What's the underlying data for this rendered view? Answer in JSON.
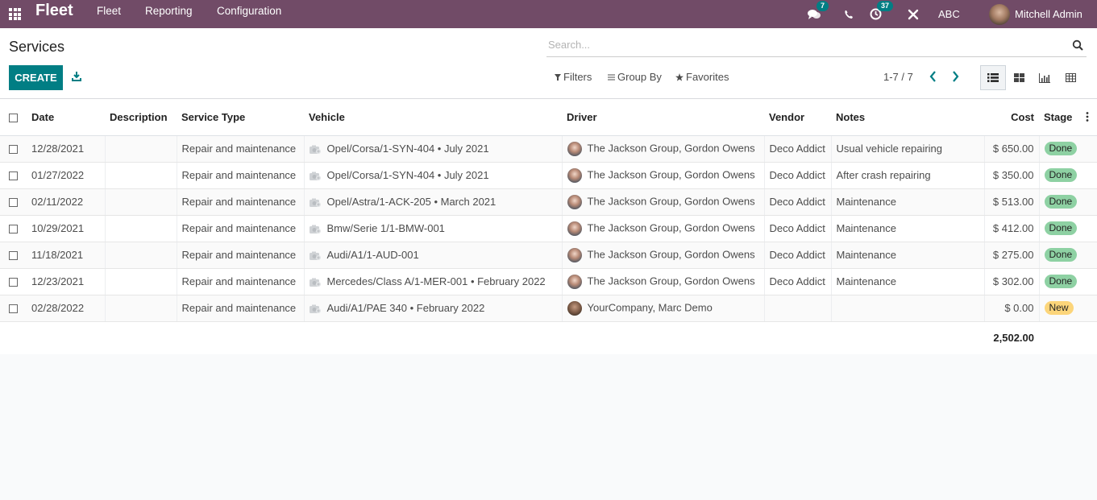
{
  "navbar": {
    "brand": "Fleet",
    "menu": [
      {
        "label": "Fleet"
      },
      {
        "label": "Reporting"
      },
      {
        "label": "Configuration"
      }
    ],
    "messages_count": "7",
    "activities_count": "37",
    "company": "ABC",
    "user": "Mitchell Admin"
  },
  "control_panel": {
    "title": "Services",
    "create_label": "CREATE",
    "search_placeholder": "Search...",
    "filters_label": "Filters",
    "group_by_label": "Group By",
    "favorites_label": "Favorites",
    "pager": "1-7 / 7"
  },
  "colors": {
    "brand": "#714b67",
    "primary": "#017e84",
    "done": "#8ed1a3",
    "new": "#fcd57a"
  },
  "table": {
    "columns": {
      "date": "Date",
      "description": "Description",
      "service_type": "Service Type",
      "vehicle": "Vehicle",
      "driver": "Driver",
      "vendor": "Vendor",
      "notes": "Notes",
      "cost": "Cost",
      "stage": "Stage"
    },
    "rows": [
      {
        "date": "12/28/2021",
        "description": "",
        "service_type": "Repair and maintenance",
        "vehicle": "Opel/Corsa/1-SYN-404 • July 2021",
        "driver": "The Jackson Group, Gordon Owens",
        "vendor": "Deco Addict",
        "notes": "Usual vehicle repairing",
        "cost": "$ 650.00",
        "stage": "Done"
      },
      {
        "date": "01/27/2022",
        "description": "",
        "service_type": "Repair and maintenance",
        "vehicle": "Opel/Corsa/1-SYN-404 • July 2021",
        "driver": "The Jackson Group, Gordon Owens",
        "vendor": "Deco Addict",
        "notes": "After crash repairing",
        "cost": "$ 350.00",
        "stage": "Done"
      },
      {
        "date": "02/11/2022",
        "description": "",
        "service_type": "Repair and maintenance",
        "vehicle": "Opel/Astra/1-ACK-205 • March 2021",
        "driver": "The Jackson Group, Gordon Owens",
        "vendor": "Deco Addict",
        "notes": "Maintenance",
        "cost": "$ 513.00",
        "stage": "Done"
      },
      {
        "date": "10/29/2021",
        "description": "",
        "service_type": "Repair and maintenance",
        "vehicle": "Bmw/Serie 1/1-BMW-001",
        "driver": "The Jackson Group, Gordon Owens",
        "vendor": "Deco Addict",
        "notes": "Maintenance",
        "cost": "$ 412.00",
        "stage": "Done"
      },
      {
        "date": "11/18/2021",
        "description": "",
        "service_type": "Repair and maintenance",
        "vehicle": "Audi/A1/1-AUD-001",
        "driver": "The Jackson Group, Gordon Owens",
        "vendor": "Deco Addict",
        "notes": "Maintenance",
        "cost": "$ 275.00",
        "stage": "Done"
      },
      {
        "date": "12/23/2021",
        "description": "",
        "service_type": "Repair and maintenance",
        "vehicle": "Mercedes/Class A/1-MER-001 • February 2022",
        "driver": "The Jackson Group, Gordon Owens",
        "vendor": "Deco Addict",
        "notes": "Maintenance",
        "cost": "$ 302.00",
        "stage": "Done"
      },
      {
        "date": "02/28/2022",
        "description": "",
        "service_type": "Repair and maintenance",
        "vehicle": "Audi/A1/PAE 340 • February 2022",
        "driver": "YourCompany, Marc Demo",
        "vendor": "",
        "notes": "",
        "cost": "$ 0.00",
        "stage": "New"
      }
    ],
    "total_cost": "2,502.00"
  }
}
